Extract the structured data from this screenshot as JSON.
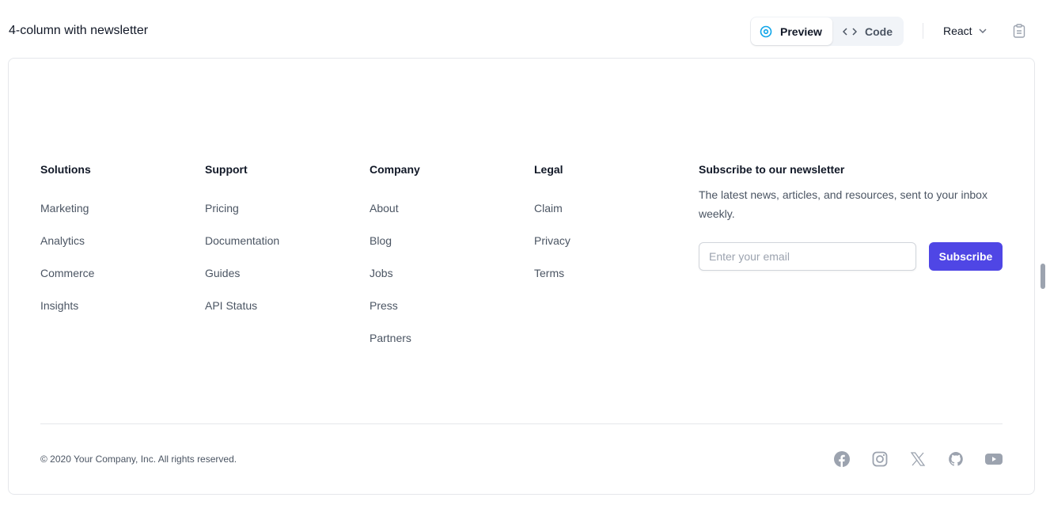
{
  "header": {
    "title": "4-column with newsletter",
    "preview_label": "Preview",
    "code_label": "Code",
    "framework": "React"
  },
  "columns": [
    {
      "title": "Solutions",
      "links": [
        "Marketing",
        "Analytics",
        "Commerce",
        "Insights"
      ]
    },
    {
      "title": "Support",
      "links": [
        "Pricing",
        "Documentation",
        "Guides",
        "API Status"
      ]
    },
    {
      "title": "Company",
      "links": [
        "About",
        "Blog",
        "Jobs",
        "Press",
        "Partners"
      ]
    },
    {
      "title": "Legal",
      "links": [
        "Claim",
        "Privacy",
        "Terms"
      ]
    }
  ],
  "newsletter": {
    "title": "Subscribe to our newsletter",
    "text": "The latest news, articles, and resources, sent to your inbox weekly.",
    "placeholder": "Enter your email",
    "button": "Subscribe"
  },
  "footer": {
    "copyright": "© 2020 Your Company, Inc. All rights reserved.",
    "social": [
      "facebook-icon",
      "instagram-icon",
      "x-icon",
      "github-icon",
      "youtube-icon"
    ]
  },
  "colors": {
    "accent": "#4f46e5",
    "preview_icon": "#0ea5e9"
  }
}
